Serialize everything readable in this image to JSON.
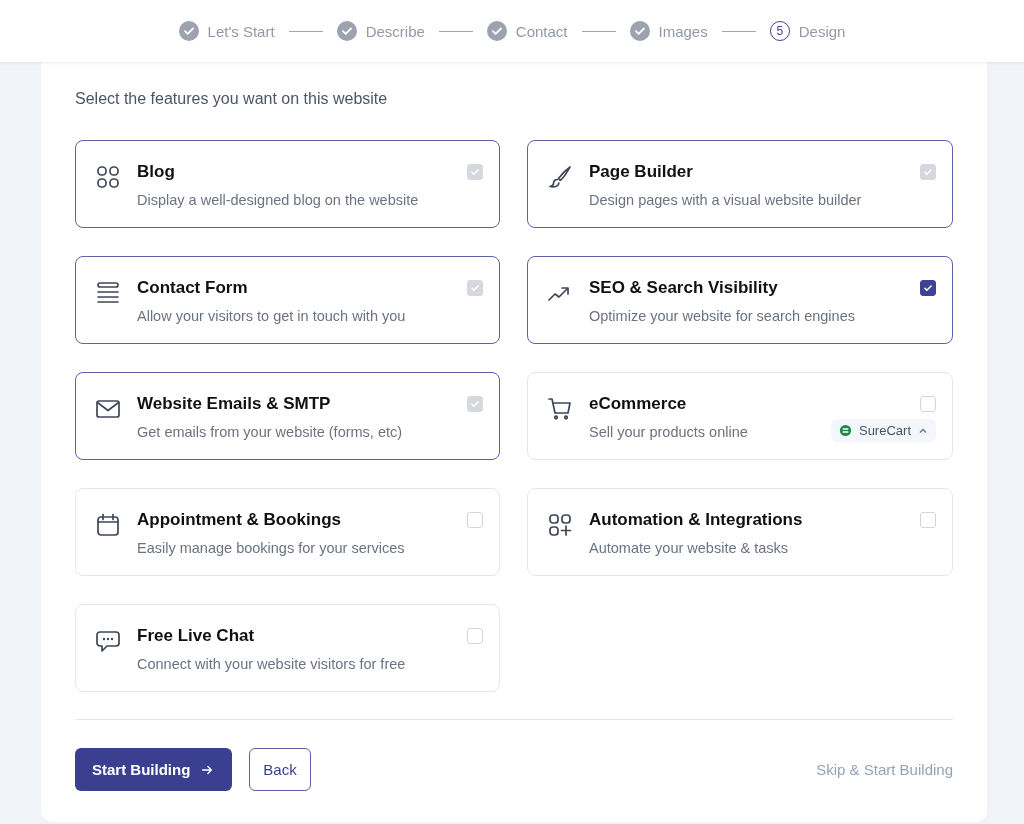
{
  "steps": [
    {
      "label": "Let's Start",
      "done": true
    },
    {
      "label": "Describe",
      "done": true
    },
    {
      "label": "Contact",
      "done": true
    },
    {
      "label": "Images",
      "done": true
    },
    {
      "label": "Design",
      "number": "5",
      "done": false
    }
  ],
  "subtitle": "Select the features you want on this website",
  "features": [
    {
      "name": "Blog",
      "description": "Display a well-designed blog on the website",
      "checked": true,
      "disabled": true
    },
    {
      "name": "Page Builder",
      "description": "Design pages with a visual website builder",
      "checked": true,
      "disabled": true
    },
    {
      "name": "Contact Form",
      "description": "Allow your visitors to get in touch with you",
      "checked": true,
      "disabled": true
    },
    {
      "name": "SEO & Search Visibility",
      "description": "Optimize your website for search engines",
      "checked": true,
      "disabled": false
    },
    {
      "name": "Website Emails & SMTP",
      "description": "Get emails from your website (forms, etc)",
      "checked": true,
      "disabled": true
    },
    {
      "name": "eCommerce",
      "description": "Sell your products online",
      "checked": false,
      "disabled": false,
      "addon": {
        "label": "SureCart",
        "expanded": true
      }
    },
    {
      "name": "Appointment & Bookings",
      "description": "Easily manage bookings for your services",
      "checked": false,
      "disabled": false
    },
    {
      "name": "Automation & Integrations",
      "description": "Automate your website & tasks",
      "checked": false,
      "disabled": false
    },
    {
      "name": "Free Live Chat",
      "description": "Connect with your website visitors for free",
      "checked": false,
      "disabled": false
    }
  ],
  "buttons": {
    "primary": "Start Building",
    "back": "Back",
    "skip": "Skip & Start Building"
  }
}
